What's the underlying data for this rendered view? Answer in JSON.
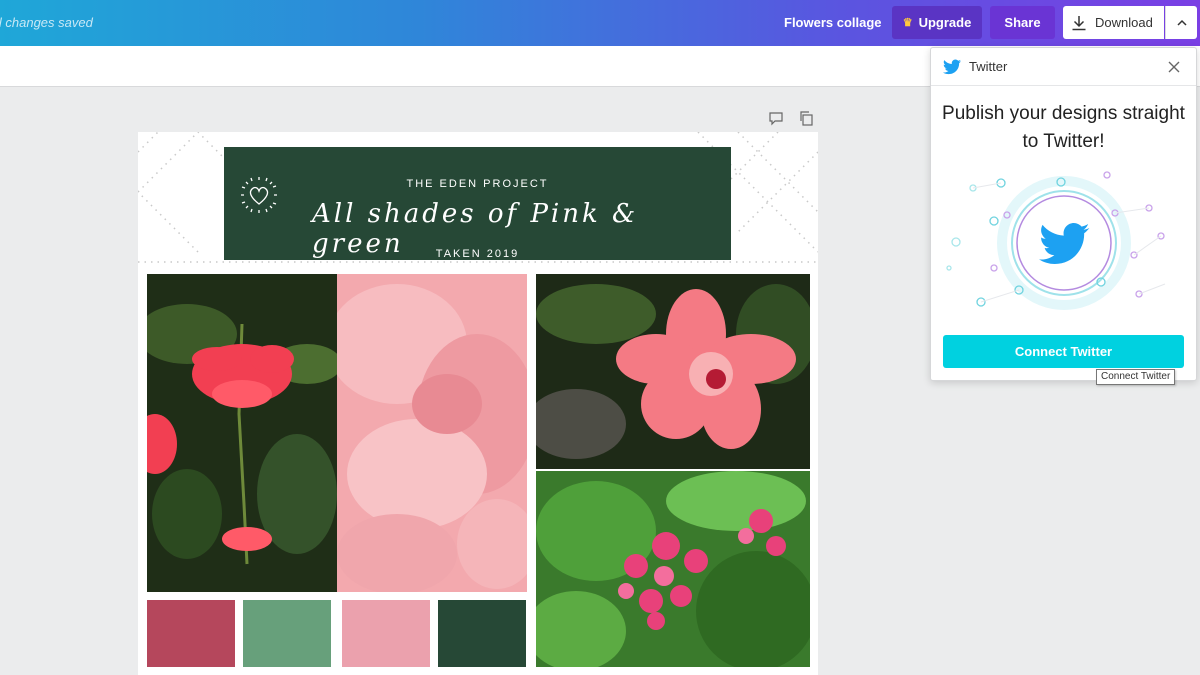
{
  "header": {
    "save_status": "ll changes saved",
    "doc_title": "Flowers collage",
    "upgrade_label": "Upgrade",
    "share_label": "Share",
    "download_label": "Download"
  },
  "design": {
    "kicker": "THE EDEN PROJECT",
    "headline": "All shades of Pink & green",
    "subline": "TAKEN 2019",
    "palette": [
      "#b5475c",
      "#67a07b",
      "#eba1ad",
      "#264836"
    ]
  },
  "twitter_panel": {
    "title": "Twitter",
    "heading": "Publish your designs straight to Twitter!",
    "connect_label": "Connect Twitter",
    "tooltip": "Connect Twitter",
    "accent": "#00d1e0",
    "twitter_blue": "#1da1f2"
  },
  "icons": [
    "download-icon",
    "chevron-up-icon",
    "crown-icon",
    "comment-icon",
    "copy-page-icon",
    "twitter-bird-icon",
    "close-icon",
    "heart-icon"
  ]
}
